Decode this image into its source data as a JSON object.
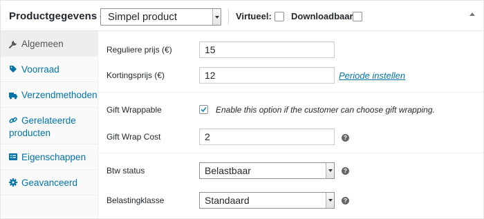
{
  "header": {
    "title": "Productgegevens —",
    "product_type": "Simpel product",
    "virtual_label": "Virtueel:",
    "downloadable_label": "Downloadbaar:"
  },
  "tabs": [
    {
      "label": "Algemeen",
      "icon": "wrench-icon",
      "active": true
    },
    {
      "label": "Voorraad",
      "icon": "tag-icon"
    },
    {
      "label": "Verzendmethoden",
      "icon": "truck-icon"
    },
    {
      "label_line1": "Gerelateerde",
      "label_line2": "producten",
      "icon": "link-icon"
    },
    {
      "label": "Eigenschappen",
      "icon": "list-icon"
    },
    {
      "label": "Geavanceerd",
      "icon": "gear-icon"
    }
  ],
  "pricing": {
    "regular_label": "Reguliere prijs (€)",
    "regular_value": "15",
    "sale_label": "Kortingsprijs (€)",
    "sale_value": "12",
    "schedule_link": "Periode instellen"
  },
  "gift": {
    "wrappable_label": "Gift Wrappable",
    "wrappable_checked": true,
    "wrappable_desc": "Enable this option if the customer can choose gift wrapping.",
    "cost_label": "Gift Wrap Cost",
    "cost_value": "2"
  },
  "tax": {
    "status_label": "Btw status",
    "status_value": "Belastbaar",
    "class_label": "Belastingklasse",
    "class_value": "Standaard"
  },
  "colors": {
    "link": "#0073aa",
    "check": "#1e8cbe"
  }
}
